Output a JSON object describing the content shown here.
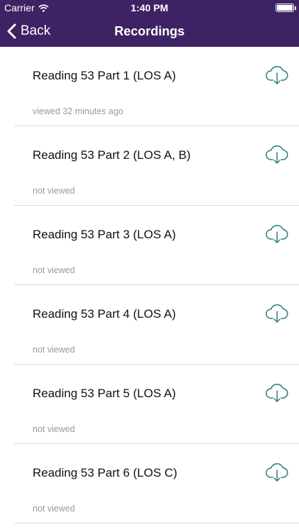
{
  "status_bar": {
    "carrier": "Carrier",
    "time": "1:40 PM",
    "battery_level": 1.0
  },
  "nav": {
    "back_label": "Back",
    "title": "Recordings"
  },
  "icons": {
    "download": "cloud-download-icon",
    "back": "chevron-left-icon",
    "wifi": "wifi-icon",
    "battery": "battery-icon"
  },
  "colors": {
    "nav_background": "#3d2363",
    "download_icon": "#2f7f80",
    "subtitle": "#9a9a9a"
  },
  "recordings": [
    {
      "title": "Reading 53 Part 1 (LOS A)",
      "status": "viewed 32 minutes ago"
    },
    {
      "title": "Reading 53 Part 2 (LOS A, B)",
      "status": "not viewed"
    },
    {
      "title": "Reading 53 Part 3 (LOS A)",
      "status": "not viewed"
    },
    {
      "title": "Reading 53 Part 4 (LOS A)",
      "status": "not viewed"
    },
    {
      "title": "Reading 53 Part 5 (LOS A)",
      "status": "not viewed"
    },
    {
      "title": "Reading 53 Part 6 (LOS C)",
      "status": "not viewed"
    }
  ]
}
